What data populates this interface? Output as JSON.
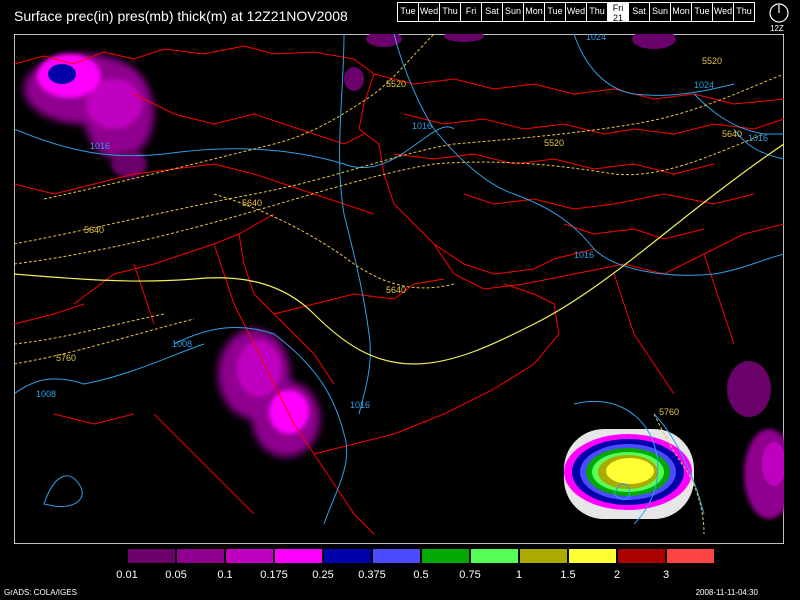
{
  "title": "Surface prec(in) pres(mb) thick(m) at 12Z21NOV2008",
  "days": [
    {
      "label": "Tue",
      "active": false
    },
    {
      "label": "Wed",
      "active": false
    },
    {
      "label": "Thu",
      "active": false
    },
    {
      "label": "Fri",
      "active": false
    },
    {
      "label": "Sat",
      "active": false
    },
    {
      "label": "Sun",
      "active": false
    },
    {
      "label": "Mon",
      "active": false
    },
    {
      "label": "Tue",
      "active": false
    },
    {
      "label": "Wed",
      "active": false
    },
    {
      "label": "Thu",
      "active": false
    },
    {
      "label": "Fri",
      "active": true,
      "num": "21"
    },
    {
      "label": "Sat",
      "active": false
    },
    {
      "label": "Sun",
      "active": false
    },
    {
      "label": "Mon",
      "active": false
    },
    {
      "label": "Tue",
      "active": false
    },
    {
      "label": "Wed",
      "active": false
    },
    {
      "label": "Thu",
      "active": false
    }
  ],
  "clock_label": "12Z",
  "contour_labels": {
    "pressure": [
      "1016",
      "1016",
      "1008",
      "1008",
      "1016",
      "1016",
      "1024",
      "1024",
      "1016"
    ],
    "thickness": [
      "5520",
      "5520",
      "5520",
      "5640",
      "5640",
      "5640",
      "5640",
      "5760",
      "5760"
    ]
  },
  "colors": {
    "border": "#ff0000",
    "pressure": "#2f9fe6",
    "thickness_low": "#e8c24a",
    "thickness_5700": "#f2ee5a"
  },
  "legend": {
    "colors": [
      "#000000",
      "#6a006a",
      "#8f008f",
      "#c000c0",
      "#ff00ff",
      "#0000aa",
      "#4b4bff",
      "#00a800",
      "#55ff55",
      "#aaaa00",
      "#ffff33",
      "#aa0000",
      "#ff4444"
    ],
    "labels": [
      "0.01",
      "0.05",
      "0.1",
      "0.175",
      "0.25",
      "0.375",
      "0.5",
      "0.75",
      "1",
      "1.5",
      "2",
      "3"
    ]
  },
  "credit": "GrADS: COLA/IGES",
  "stamp": "2008-11-11-04:30"
}
